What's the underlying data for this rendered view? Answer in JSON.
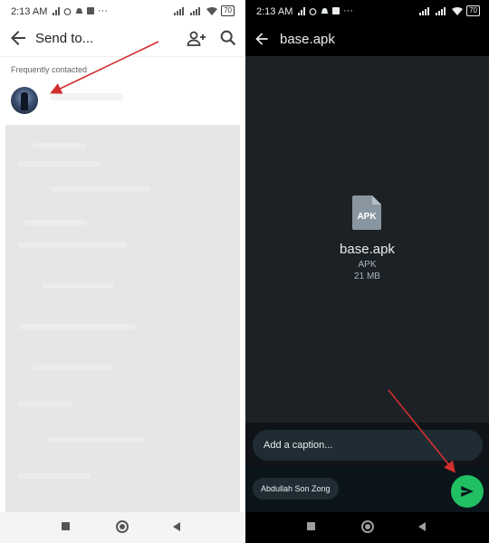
{
  "status_bar": {
    "time": "2:13 AM",
    "dots": "···",
    "battery": "70"
  },
  "left": {
    "header": {
      "title": "Send to...",
      "back_icon": "arrow-left-icon",
      "add_contact_icon": "add-person-icon",
      "search_icon": "search-icon"
    },
    "frequently_contacted_label": "Frequently contacted",
    "contact_avatar": "avatar"
  },
  "right": {
    "header": {
      "title": "base.apk",
      "back_icon": "arrow-left-icon"
    },
    "file": {
      "icon_label": "APK",
      "name": "base.apk",
      "type": "APK",
      "size": "21 MB"
    },
    "caption_placeholder": "Add a caption...",
    "recipient_chip": "Abdullah Son Zong",
    "send_icon": "send-icon"
  },
  "colors": {
    "annotation_arrow": "#d32f2f",
    "send_button": "#21c063",
    "dark_background": "#1c2125"
  }
}
